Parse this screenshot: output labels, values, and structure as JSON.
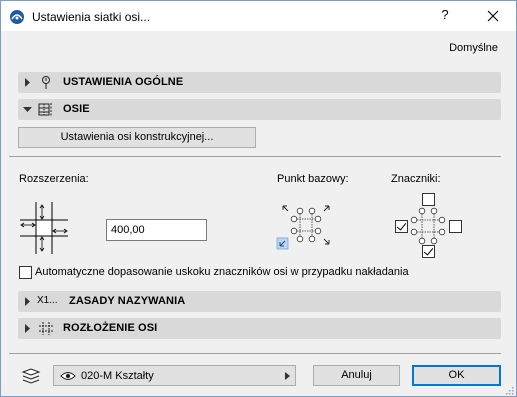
{
  "window": {
    "title": "Ustawienia siatki osi...",
    "help_label": "?"
  },
  "header": {
    "defaults_label": "Domyślne"
  },
  "sections": {
    "general": {
      "label": "USTAWIENIA OGÓLNE",
      "expanded": false,
      "icon": "pin-icon"
    },
    "axes": {
      "label": "OSIE",
      "expanded": true,
      "icon": "axis-pattern-icon"
    },
    "naming": {
      "label": "ZASADY NAZYWANIA",
      "expanded": false,
      "icon": "x1-naming-icon",
      "icon_text": "X1..."
    },
    "layout": {
      "label": "ROZŁOŻENIE OSI",
      "expanded": false,
      "icon": "grid-layout-icon"
    }
  },
  "axes": {
    "structural_button_label": "Ustawienia osi konstrukcyjnej...",
    "extensions_label": "Rozszerzenia:",
    "extension_value": "400,00",
    "base_point_label": "Punkt bazowy:",
    "markers_label": "Znaczniki:",
    "markers": {
      "top": false,
      "left": true,
      "right": false,
      "bottom": true
    },
    "auto_adjust_label": "Automatyczne dopasowanie uskoku znaczników osi w przypadku nakładania",
    "auto_adjust_checked": false
  },
  "footer": {
    "layer_name": "020-M Kształty",
    "cancel_label": "Anuluj",
    "ok_label": "OK"
  },
  "colors": {
    "accent": "#0078d7",
    "section_bg": "#d9d9d9",
    "dialog_bg": "#f0f0f0"
  }
}
